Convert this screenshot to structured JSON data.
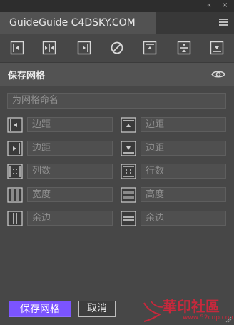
{
  "window": {
    "collapse_glyph": "«",
    "close_glyph": "×"
  },
  "tab": {
    "title": "GuideGuide C4DSKY.COM"
  },
  "toolbar": {
    "buttons": [
      {
        "icon": "guide-left-icon"
      },
      {
        "icon": "guide-vertical-midpoint-icon"
      },
      {
        "icon": "guide-right-icon"
      },
      {
        "icon": "clear-guides-icon"
      },
      {
        "icon": "guide-top-icon"
      },
      {
        "icon": "guide-horizontal-midpoint-icon"
      },
      {
        "icon": "guide-bottom-icon"
      }
    ]
  },
  "section": {
    "title": "保存网格",
    "icon": "eye-icon"
  },
  "name_field": {
    "placeholder": "为网格命名"
  },
  "fields": {
    "left_margin": "边距",
    "top_margin": "边距",
    "right_margin": "边距",
    "bottom_margin": "边距",
    "columns": "列数",
    "rows": "行数",
    "column_width": "宽度",
    "row_height": "高度",
    "column_gutter": "余边",
    "row_gutter": "余边"
  },
  "buttons": {
    "save": "保存网格",
    "cancel": "取消"
  },
  "watermark": {
    "text": "華印社區",
    "url": "www.52cnp.com"
  },
  "colors": {
    "accent": "#7b54ff",
    "panel": "#474747",
    "header": "#535353"
  }
}
